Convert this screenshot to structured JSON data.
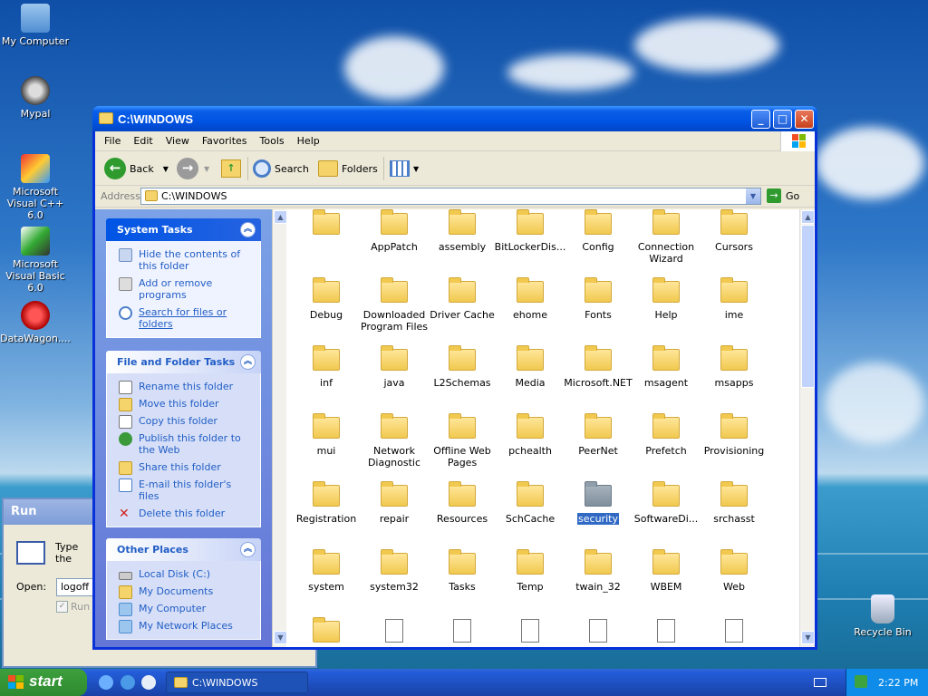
{
  "desktop": {
    "icons": [
      {
        "label": "My Computer",
        "icon": "my-computer-icon"
      },
      {
        "label": "Mypal",
        "icon": "raccoon-icon"
      },
      {
        "label": "Microsoft Visual C++ 6.0",
        "icon": "visual-cpp-icon"
      },
      {
        "label": "Microsoft Visual Basic 6.0",
        "icon": "visual-basic-icon"
      },
      {
        "label": "DataWagon....",
        "icon": "datawagon-icon"
      },
      {
        "label": "Recycle Bin",
        "icon": "recycle-bin-icon"
      }
    ]
  },
  "run_dialog": {
    "title": "Run",
    "description": "Type the name of a program, folder, document, or Internet",
    "open_label": "Open:",
    "open_value": "logoff",
    "checkbox_label": "Run in"
  },
  "window": {
    "title": "C:\\WINDOWS",
    "menu": [
      "File",
      "Edit",
      "View",
      "Favorites",
      "Tools",
      "Help"
    ],
    "toolbar": {
      "back": "Back",
      "search": "Search",
      "folders": "Folders"
    },
    "address_label": "Address",
    "address_value": "C:\\WINDOWS",
    "go_label": "Go",
    "system_tasks": {
      "title": "System Tasks",
      "items": [
        "Hide the contents of this folder",
        "Add or remove programs",
        "Search for files or folders"
      ]
    },
    "file_folder_tasks": {
      "title": "File and Folder Tasks",
      "items": [
        "Rename this folder",
        "Move this folder",
        "Copy this folder",
        "Publish this folder to the Web",
        "Share this folder",
        "E-mail this folder's files",
        "Delete this folder"
      ]
    },
    "other_places": {
      "title": "Other Places",
      "items": [
        "Local Disk (C:)",
        "My Documents",
        "My Computer",
        "My Network Places"
      ]
    },
    "files": [
      "",
      "AppPatch",
      "assembly",
      "BitLockerDis...",
      "Config",
      "Connection Wizard",
      "Cursors",
      "Debug",
      "Downloaded Program Files",
      "Driver Cache",
      "ehome",
      "Fonts",
      "Help",
      "ime",
      "inf",
      "java",
      "L2Schemas",
      "Media",
      "Microsoft.NET",
      "msagent",
      "msapps",
      "mui",
      "Network Diagnostic",
      "Offline Web Pages",
      "pchealth",
      "PeerNet",
      "Prefetch",
      "Provisioning",
      "Registration",
      "repair",
      "Resources",
      "SchCache",
      "security",
      "SoftwareDi...",
      "srchasst",
      "system",
      "system32",
      "Tasks",
      "Temp",
      "twain_32",
      "WBEM",
      "Web"
    ],
    "selected_file": "security"
  },
  "taskbar": {
    "start_label": "start",
    "task_label": "C:\\WINDOWS",
    "clock": "2:22 PM"
  }
}
